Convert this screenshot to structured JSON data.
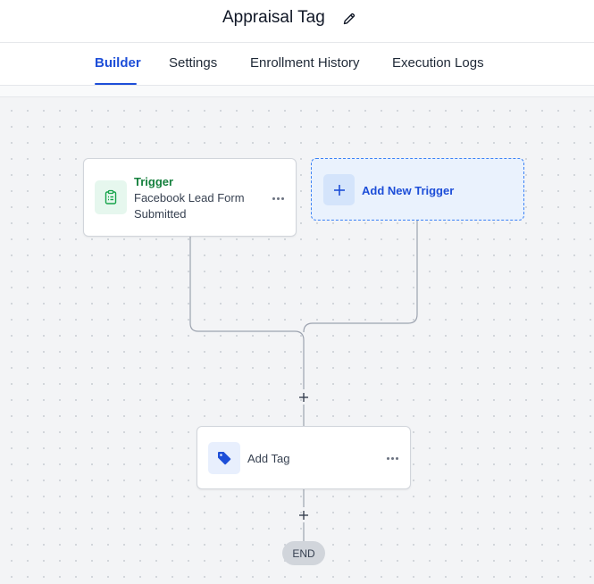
{
  "header": {
    "title": "Appraisal Tag",
    "edit_icon": "pencil-icon"
  },
  "tabs": [
    {
      "label": "Builder",
      "active": true
    },
    {
      "label": "Settings",
      "active": false
    },
    {
      "label": "Enrollment History",
      "active": false
    },
    {
      "label": "Execution Logs",
      "active": false
    }
  ],
  "workflow": {
    "trigger": {
      "label": "Trigger",
      "description": "Facebook Lead Form Submitted",
      "icon": "clipboard-list-icon",
      "menu_icon": "more-horizontal-icon"
    },
    "add_trigger": {
      "label": "Add New Trigger",
      "icon": "plus-icon"
    },
    "action": {
      "label": "Add Tag",
      "icon": "tag-icon",
      "menu_icon": "more-horizontal-icon"
    },
    "end_label": "END"
  },
  "colors": {
    "accent": "#1d4ed8",
    "trigger_green": "#15803d",
    "connector": "#9ca3af"
  }
}
